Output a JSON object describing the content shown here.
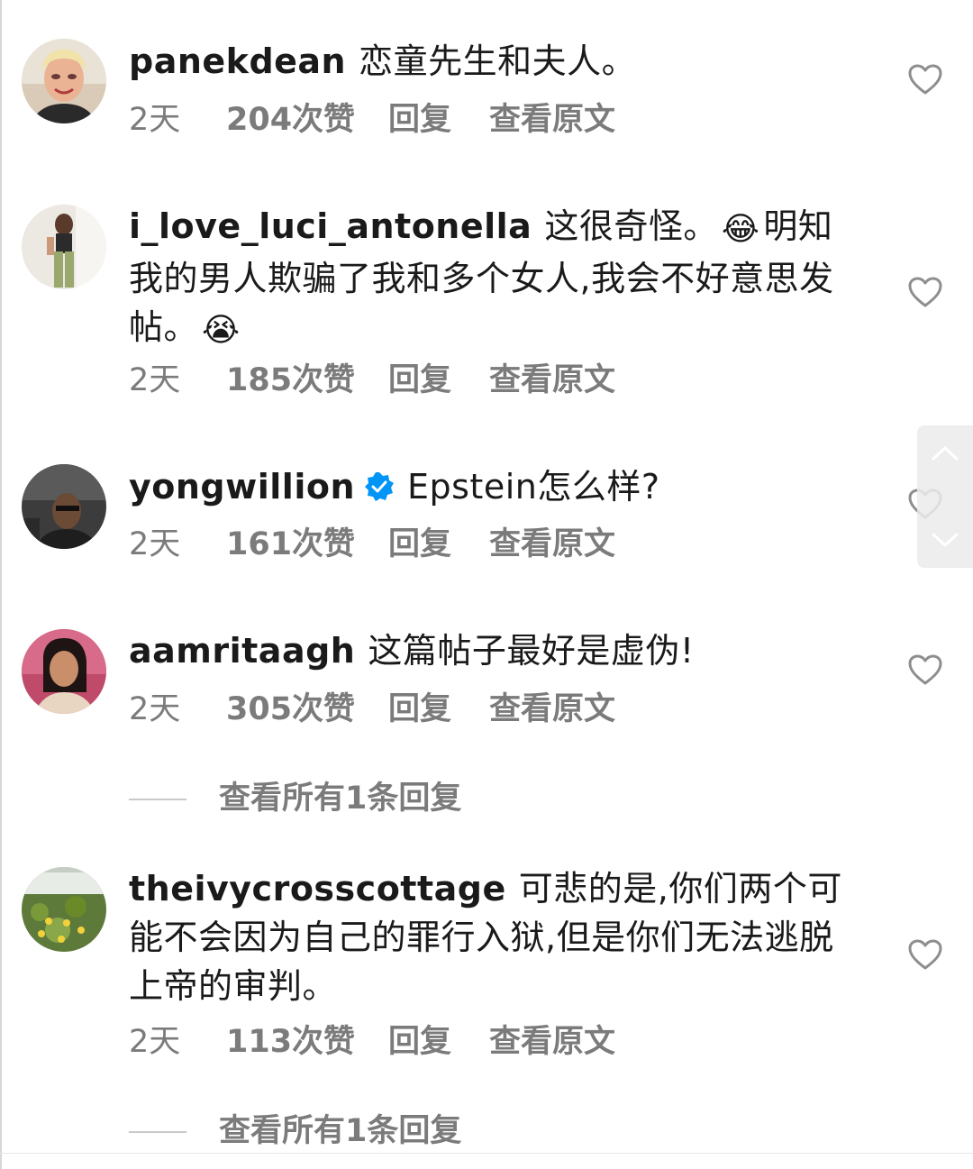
{
  "comments": [
    {
      "username": "panekdean",
      "text": "恋童先生和夫人。",
      "time": "2天",
      "likes": "204次赞",
      "reply": "回复",
      "view_original": "查看原文"
    },
    {
      "username": "i_love_luci_antonella",
      "text_part1": "这很奇怪。",
      "emoji1": "😂",
      "text_part2": "明知我的男人欺骗了我和多个女人,我会不好意思发帖。",
      "emoji2": "😭",
      "time": "2天",
      "likes": "185次赞",
      "reply": "回复",
      "view_original": "查看原文"
    },
    {
      "username": "yongwillion",
      "text": "Epstein怎么样?",
      "time": "2天",
      "likes": "161次赞",
      "reply": "回复",
      "view_original": "查看原文"
    },
    {
      "username": "aamritaagh",
      "text": "这篇帖子最好是虚伪!",
      "time": "2天",
      "likes": "305次赞",
      "reply": "回复",
      "view_original": "查看原文",
      "view_replies": "查看所有1条回复"
    },
    {
      "username": "theivycrosscottage",
      "text": "可悲的是,你们两个可能不会因为自己的罪行入狱,但是你们无法逃脱上帝的审判。",
      "time": "2天",
      "likes": "113次赞",
      "reply": "回复",
      "view_original": "查看原文",
      "view_replies": "查看所有1条回复"
    }
  ],
  "colors": {
    "text": "#1a1a1a",
    "meta": "#7b7b7b",
    "verified_blue": "#0095f6",
    "heart_stroke": "#8e8e8e"
  },
  "icons": [
    "heart-icon",
    "verified-badge-icon",
    "chevron-up-icon",
    "chevron-down-icon"
  ]
}
